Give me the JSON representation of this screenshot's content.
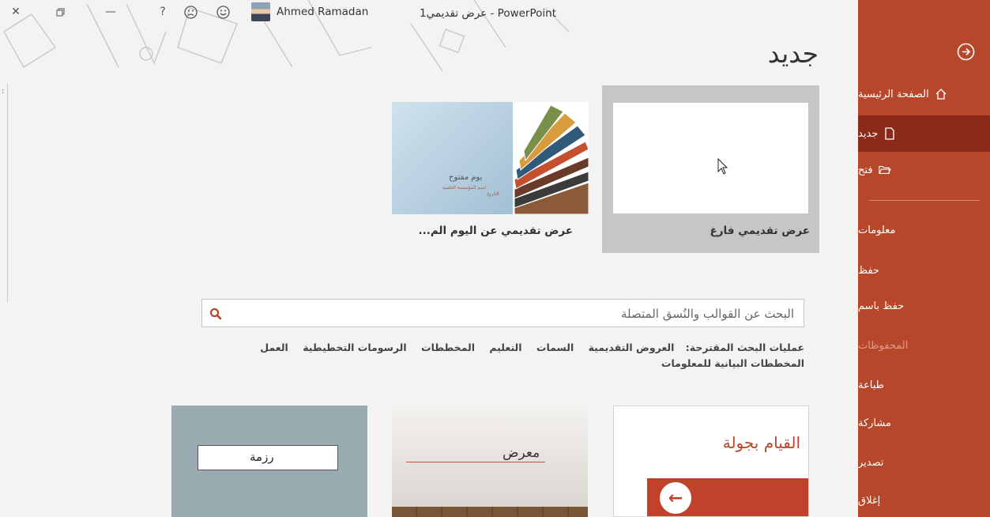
{
  "titlebar": {
    "user_name": "Ahmed Ramadan",
    "document_title": "عرض تقديمي1  -  PowerPoint",
    "buttons": [
      "close",
      "restore",
      "minimize",
      "help",
      "frown",
      "smile"
    ]
  },
  "page": {
    "title": "جديد"
  },
  "featured_templates": [
    {
      "label": "عرض تقديمي فارغ"
    },
    {
      "label": "عرض تقديمي عن اليوم الم...",
      "thumb_title": "يوم مفتوح",
      "thumb_sub1": "اسم المؤسسة العلمية",
      "thumb_sub2": "التاريخ"
    }
  ],
  "search": {
    "placeholder": "البحث عن القوالب والنُسق المتصلة",
    "suggested_label": "عمليات البحث المقترحة:",
    "suggestions": [
      "العروض التقديمية",
      "السمات",
      "التعليم",
      "المخططات",
      "الرسومات التخطيطية",
      "العمل",
      "المخططات البيانية للمعلومات"
    ]
  },
  "gallery": [
    {
      "title": "القيام بجولة"
    },
    {
      "title": "معرض"
    },
    {
      "title": "رزمة"
    }
  ],
  "sidebar": {
    "items": [
      {
        "label": "الصفحة الرئيسية",
        "icon": "home-icon"
      },
      {
        "label": "جديد",
        "icon": "new-document-icon",
        "active": true
      },
      {
        "label": "فتح",
        "icon": "open-folder-icon"
      },
      {
        "label": "معلومات"
      },
      {
        "label": "حفظ"
      },
      {
        "label": "حفظ باسم"
      },
      {
        "label": "المحفوظات",
        "disabled": true
      },
      {
        "label": "طباعة"
      },
      {
        "label": "مشاركة"
      },
      {
        "label": "تصدير"
      },
      {
        "label": "إغلاق"
      }
    ]
  },
  "colors": {
    "accent": "#b7472a",
    "active": "#8c2a1a",
    "background": "#f3f3f3"
  }
}
